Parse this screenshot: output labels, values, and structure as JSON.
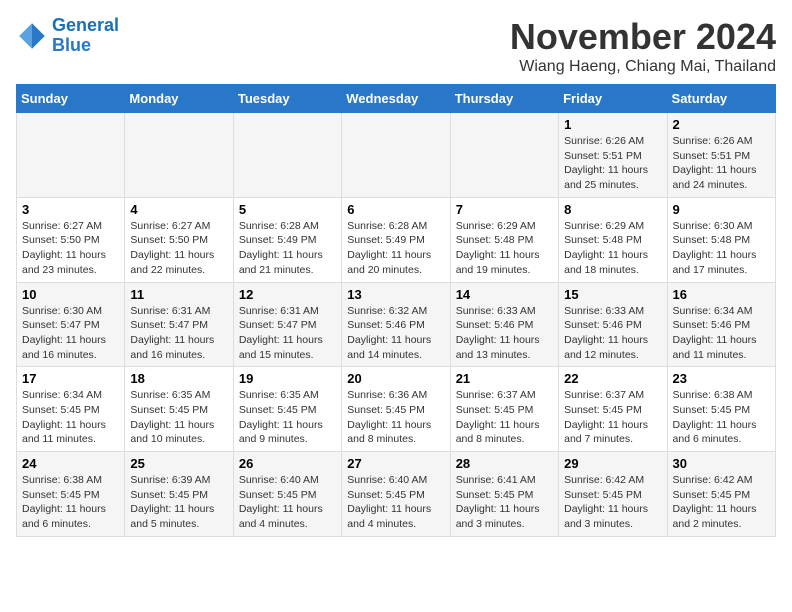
{
  "logo": {
    "line1": "General",
    "line2": "Blue"
  },
  "title": "November 2024",
  "subtitle": "Wiang Haeng, Chiang Mai, Thailand",
  "weekdays": [
    "Sunday",
    "Monday",
    "Tuesday",
    "Wednesday",
    "Thursday",
    "Friday",
    "Saturday"
  ],
  "weeks": [
    [
      {
        "day": "",
        "sunrise": "",
        "sunset": "",
        "daylight": ""
      },
      {
        "day": "",
        "sunrise": "",
        "sunset": "",
        "daylight": ""
      },
      {
        "day": "",
        "sunrise": "",
        "sunset": "",
        "daylight": ""
      },
      {
        "day": "",
        "sunrise": "",
        "sunset": "",
        "daylight": ""
      },
      {
        "day": "",
        "sunrise": "",
        "sunset": "",
        "daylight": ""
      },
      {
        "day": "1",
        "sunrise": "Sunrise: 6:26 AM",
        "sunset": "Sunset: 5:51 PM",
        "daylight": "Daylight: 11 hours and 25 minutes."
      },
      {
        "day": "2",
        "sunrise": "Sunrise: 6:26 AM",
        "sunset": "Sunset: 5:51 PM",
        "daylight": "Daylight: 11 hours and 24 minutes."
      }
    ],
    [
      {
        "day": "3",
        "sunrise": "Sunrise: 6:27 AM",
        "sunset": "Sunset: 5:50 PM",
        "daylight": "Daylight: 11 hours and 23 minutes."
      },
      {
        "day": "4",
        "sunrise": "Sunrise: 6:27 AM",
        "sunset": "Sunset: 5:50 PM",
        "daylight": "Daylight: 11 hours and 22 minutes."
      },
      {
        "day": "5",
        "sunrise": "Sunrise: 6:28 AM",
        "sunset": "Sunset: 5:49 PM",
        "daylight": "Daylight: 11 hours and 21 minutes."
      },
      {
        "day": "6",
        "sunrise": "Sunrise: 6:28 AM",
        "sunset": "Sunset: 5:49 PM",
        "daylight": "Daylight: 11 hours and 20 minutes."
      },
      {
        "day": "7",
        "sunrise": "Sunrise: 6:29 AM",
        "sunset": "Sunset: 5:48 PM",
        "daylight": "Daylight: 11 hours and 19 minutes."
      },
      {
        "day": "8",
        "sunrise": "Sunrise: 6:29 AM",
        "sunset": "Sunset: 5:48 PM",
        "daylight": "Daylight: 11 hours and 18 minutes."
      },
      {
        "day": "9",
        "sunrise": "Sunrise: 6:30 AM",
        "sunset": "Sunset: 5:48 PM",
        "daylight": "Daylight: 11 hours and 17 minutes."
      }
    ],
    [
      {
        "day": "10",
        "sunrise": "Sunrise: 6:30 AM",
        "sunset": "Sunset: 5:47 PM",
        "daylight": "Daylight: 11 hours and 16 minutes."
      },
      {
        "day": "11",
        "sunrise": "Sunrise: 6:31 AM",
        "sunset": "Sunset: 5:47 PM",
        "daylight": "Daylight: 11 hours and 16 minutes."
      },
      {
        "day": "12",
        "sunrise": "Sunrise: 6:31 AM",
        "sunset": "Sunset: 5:47 PM",
        "daylight": "Daylight: 11 hours and 15 minutes."
      },
      {
        "day": "13",
        "sunrise": "Sunrise: 6:32 AM",
        "sunset": "Sunset: 5:46 PM",
        "daylight": "Daylight: 11 hours and 14 minutes."
      },
      {
        "day": "14",
        "sunrise": "Sunrise: 6:33 AM",
        "sunset": "Sunset: 5:46 PM",
        "daylight": "Daylight: 11 hours and 13 minutes."
      },
      {
        "day": "15",
        "sunrise": "Sunrise: 6:33 AM",
        "sunset": "Sunset: 5:46 PM",
        "daylight": "Daylight: 11 hours and 12 minutes."
      },
      {
        "day": "16",
        "sunrise": "Sunrise: 6:34 AM",
        "sunset": "Sunset: 5:46 PM",
        "daylight": "Daylight: 11 hours and 11 minutes."
      }
    ],
    [
      {
        "day": "17",
        "sunrise": "Sunrise: 6:34 AM",
        "sunset": "Sunset: 5:45 PM",
        "daylight": "Daylight: 11 hours and 11 minutes."
      },
      {
        "day": "18",
        "sunrise": "Sunrise: 6:35 AM",
        "sunset": "Sunset: 5:45 PM",
        "daylight": "Daylight: 11 hours and 10 minutes."
      },
      {
        "day": "19",
        "sunrise": "Sunrise: 6:35 AM",
        "sunset": "Sunset: 5:45 PM",
        "daylight": "Daylight: 11 hours and 9 minutes."
      },
      {
        "day": "20",
        "sunrise": "Sunrise: 6:36 AM",
        "sunset": "Sunset: 5:45 PM",
        "daylight": "Daylight: 11 hours and 8 minutes."
      },
      {
        "day": "21",
        "sunrise": "Sunrise: 6:37 AM",
        "sunset": "Sunset: 5:45 PM",
        "daylight": "Daylight: 11 hours and 8 minutes."
      },
      {
        "day": "22",
        "sunrise": "Sunrise: 6:37 AM",
        "sunset": "Sunset: 5:45 PM",
        "daylight": "Daylight: 11 hours and 7 minutes."
      },
      {
        "day": "23",
        "sunrise": "Sunrise: 6:38 AM",
        "sunset": "Sunset: 5:45 PM",
        "daylight": "Daylight: 11 hours and 6 minutes."
      }
    ],
    [
      {
        "day": "24",
        "sunrise": "Sunrise: 6:38 AM",
        "sunset": "Sunset: 5:45 PM",
        "daylight": "Daylight: 11 hours and 6 minutes."
      },
      {
        "day": "25",
        "sunrise": "Sunrise: 6:39 AM",
        "sunset": "Sunset: 5:45 PM",
        "daylight": "Daylight: 11 hours and 5 minutes."
      },
      {
        "day": "26",
        "sunrise": "Sunrise: 6:40 AM",
        "sunset": "Sunset: 5:45 PM",
        "daylight": "Daylight: 11 hours and 4 minutes."
      },
      {
        "day": "27",
        "sunrise": "Sunrise: 6:40 AM",
        "sunset": "Sunset: 5:45 PM",
        "daylight": "Daylight: 11 hours and 4 minutes."
      },
      {
        "day": "28",
        "sunrise": "Sunrise: 6:41 AM",
        "sunset": "Sunset: 5:45 PM",
        "daylight": "Daylight: 11 hours and 3 minutes."
      },
      {
        "day": "29",
        "sunrise": "Sunrise: 6:42 AM",
        "sunset": "Sunset: 5:45 PM",
        "daylight": "Daylight: 11 hours and 3 minutes."
      },
      {
        "day": "30",
        "sunrise": "Sunrise: 6:42 AM",
        "sunset": "Sunset: 5:45 PM",
        "daylight": "Daylight: 11 hours and 2 minutes."
      }
    ]
  ]
}
